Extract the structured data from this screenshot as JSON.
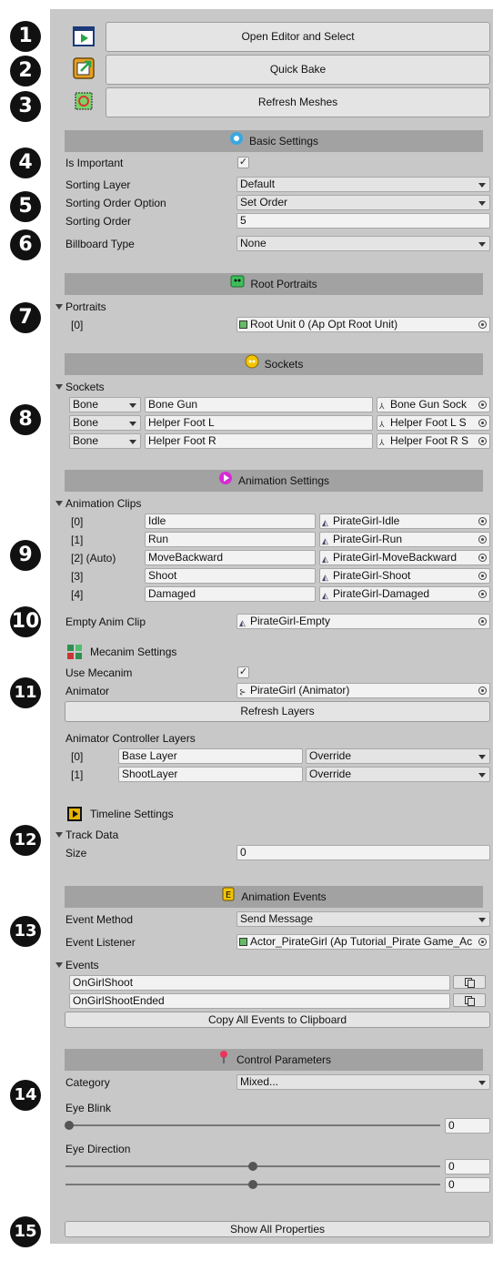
{
  "numbers": [
    "1",
    "2",
    "3",
    "4",
    "5",
    "6",
    "7",
    "8",
    "9",
    "10",
    "11",
    "12",
    "13",
    "14",
    "15"
  ],
  "top_buttons": {
    "open_editor": "Open Editor and Select",
    "quick_bake": "Quick Bake",
    "refresh_meshes": "Refresh Meshes"
  },
  "basic": {
    "title": "Basic Settings",
    "is_important_label": "Is Important",
    "sorting_layer_label": "Sorting Layer",
    "sorting_layer_value": "Default",
    "sorting_order_option_label": "Sorting Order Option",
    "sorting_order_option_value": "Set Order",
    "sorting_order_label": "Sorting Order",
    "sorting_order_value": "5",
    "billboard_label": "Billboard Type",
    "billboard_value": "None"
  },
  "root": {
    "title": "Root Portraits",
    "portraits_label": "Portraits",
    "item_index": "[0]",
    "item_value": "Root Unit 0 (Ap Opt Root Unit)"
  },
  "sockets": {
    "title": "Sockets",
    "list_label": "Sockets",
    "rows": [
      {
        "type": "Bone",
        "name": "Bone Gun",
        "ref": "Bone Gun Sock"
      },
      {
        "type": "Bone",
        "name": "Helper Foot L",
        "ref": "Helper Foot L S"
      },
      {
        "type": "Bone",
        "name": "Helper Foot R",
        "ref": "Helper Foot R S"
      }
    ]
  },
  "animation": {
    "title": "Animation Settings",
    "clips_label": "Animation Clips",
    "clips": [
      {
        "index": "[0]",
        "name": "Idle",
        "clip": "PirateGirl-Idle"
      },
      {
        "index": "[1]",
        "name": "Run",
        "clip": "PirateGirl-Run"
      },
      {
        "index": "[2] (Auto)",
        "name": "MoveBackward",
        "clip": "PirateGirl-MoveBackward"
      },
      {
        "index": "[3]",
        "name": "Shoot",
        "clip": "PirateGirl-Shoot"
      },
      {
        "index": "[4]",
        "name": "Damaged",
        "clip": "PirateGirl-Damaged"
      }
    ],
    "empty_label": "Empty Anim Clip",
    "empty_value": "PirateGirl-Empty"
  },
  "mecanim": {
    "title": "Mecanim Settings",
    "use_label": "Use Mecanim",
    "animator_label": "Animator",
    "animator_value": "PirateGirl (Animator)",
    "refresh_layers": "Refresh Layers",
    "layers_label": "Animator Controller Layers",
    "layers": [
      {
        "index": "[0]",
        "name": "Base Layer",
        "mode": "Override"
      },
      {
        "index": "[1]",
        "name": "ShootLayer",
        "mode": "Override"
      }
    ]
  },
  "timeline": {
    "title": "Timeline Settings",
    "track_label": "Track Data",
    "size_label": "Size",
    "size_value": "0"
  },
  "events": {
    "title": "Animation Events",
    "method_label": "Event Method",
    "method_value": "Send Message",
    "listener_label": "Event Listener",
    "listener_value": "Actor_PirateGirl (Ap Tutorial_Pirate Game_Ac",
    "events_label": "Events",
    "items": [
      "OnGirlShoot",
      "OnGirlShootEnded"
    ],
    "copy_all": "Copy All Events to Clipboard"
  },
  "control": {
    "title": "Control Parameters",
    "category_label": "Category",
    "category_value": "Mixed...",
    "eye_blink_label": "Eye Blink",
    "eye_blink_value": "0",
    "eye_blink_level": 0.0,
    "eye_direction_label": "Eye Direction",
    "eye_direction_x": "0",
    "eye_direction_y": "0",
    "eye_direction_x_level": 0.5,
    "eye_direction_y_level": 0.5
  },
  "show_all": "Show All Properties"
}
